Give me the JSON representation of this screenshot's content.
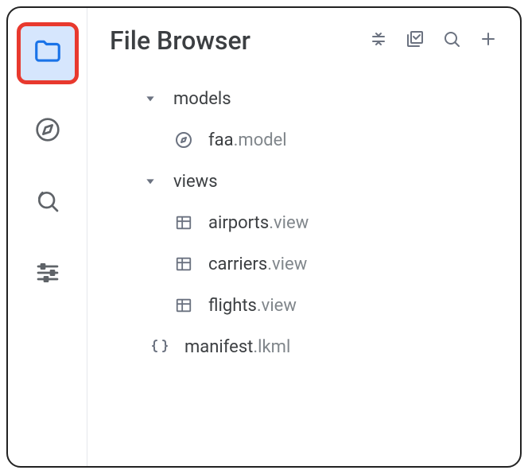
{
  "title": "File Browser",
  "sidebar": {
    "items": [
      {
        "name": "file-browser",
        "active": true
      },
      {
        "name": "compass",
        "active": false
      },
      {
        "name": "history",
        "active": false
      },
      {
        "name": "settings-sliders",
        "active": false
      }
    ]
  },
  "header_actions": {
    "collapse": "collapse",
    "bulk": "bulk-select",
    "search": "search",
    "add": "add"
  },
  "tree": {
    "folders": [
      {
        "label": "models",
        "expanded": true,
        "children": [
          {
            "base": "faa",
            "ext": ".model",
            "icon": "compass"
          }
        ]
      },
      {
        "label": "views",
        "expanded": true,
        "children": [
          {
            "base": "airports",
            "ext": ".view",
            "icon": "table"
          },
          {
            "base": "carriers",
            "ext": ".view",
            "icon": "table"
          },
          {
            "base": "flights",
            "ext": ".view",
            "icon": "table"
          }
        ]
      }
    ],
    "root_files": [
      {
        "base": "manifest",
        "ext": ".lkml",
        "icon": "braces"
      }
    ]
  }
}
